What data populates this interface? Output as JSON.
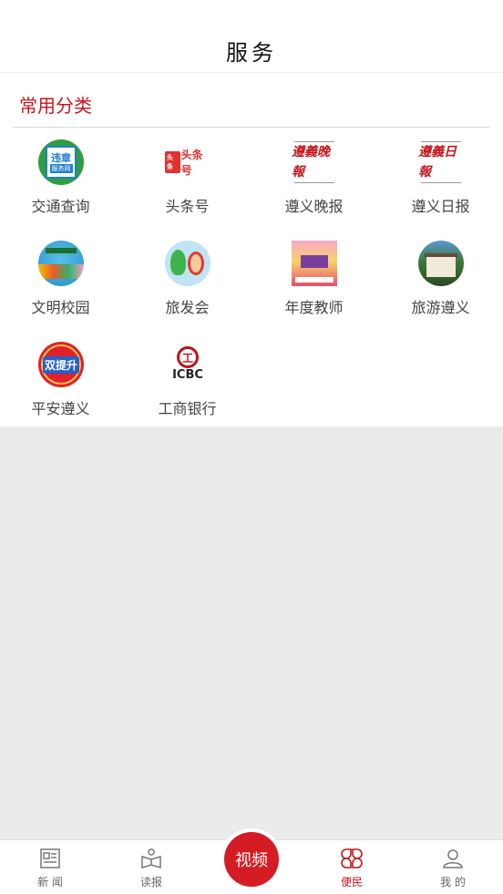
{
  "header": {
    "title": "服务"
  },
  "section": {
    "title": "常用分类"
  },
  "grid": [
    {
      "label": "交通查询",
      "icon": "traffic-service-icon",
      "text": "违章",
      "sub": "服务网"
    },
    {
      "label": "头条号",
      "icon": "toutiao-icon",
      "badge": "头条",
      "text": "头条号"
    },
    {
      "label": "遵义晚报",
      "icon": "zunyi-evening-news-icon",
      "text": "遵義晚報"
    },
    {
      "label": "遵义日报",
      "icon": "zunyi-daily-icon",
      "text": "遵義日報"
    },
    {
      "label": "文明校园",
      "icon": "civilized-campus-icon"
    },
    {
      "label": "旅发会",
      "icon": "tourism-conference-icon"
    },
    {
      "label": "年度教师",
      "icon": "teacher-of-year-icon"
    },
    {
      "label": "旅游遵义",
      "icon": "zunyi-tourism-icon"
    },
    {
      "label": "平安遵义",
      "icon": "safe-zunyi-icon",
      "text": "双提升"
    },
    {
      "label": "工商银行",
      "icon": "icbc-icon",
      "text": "ICBC",
      "logo": "工"
    }
  ],
  "tabbar": {
    "items": [
      {
        "label": "新 闻",
        "icon": "news-icon"
      },
      {
        "label": "读报",
        "icon": "read-paper-icon"
      },
      {
        "label": "便民",
        "icon": "services-icon",
        "active": true
      },
      {
        "label": "我 的",
        "icon": "profile-icon"
      }
    ],
    "video": {
      "label": "视频"
    }
  },
  "colors": {
    "accent": "#c4161c",
    "video": "#d51c24",
    "background": "#ebebeb"
  }
}
